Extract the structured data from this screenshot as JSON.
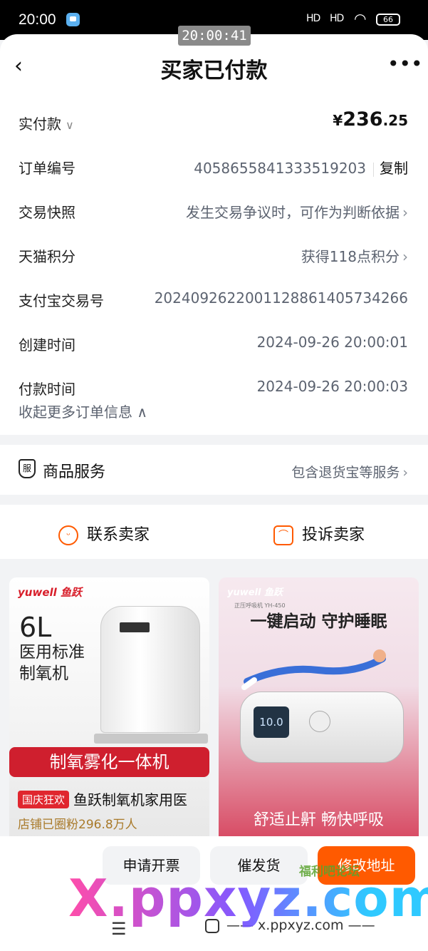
{
  "status_bar": {
    "time": "20:00",
    "signal1": "HD",
    "signal2": "HD",
    "battery": "66"
  },
  "clock_overlay": "20:00:41",
  "nav": {
    "title": "买家已付款",
    "back_icon": "‹",
    "more_icon": "•••"
  },
  "order": {
    "paid": {
      "label": "实付款",
      "caret": "∨",
      "symbol": "¥",
      "int": "236",
      "dec": ".25"
    },
    "order_no": {
      "label": "订单编号",
      "value": "4058655841333519203",
      "copy": "复制"
    },
    "snapshot": {
      "label": "交易快照",
      "value": "发生交易争议时，可作为判断依据"
    },
    "points": {
      "label": "天猫积分",
      "value": "获得118点积分"
    },
    "alipay_no": {
      "label": "支付宝交易号",
      "value": "2024092622001128861405734266"
    },
    "created": {
      "label": "创建时间",
      "value": "2024-09-26 20:00:01"
    },
    "paid_time": {
      "label": "付款时间",
      "value": "2024-09-26 20:00:03"
    },
    "collapse": "收起更多订单信息 ∧"
  },
  "service": {
    "icon_text": "服",
    "label": "商品服务",
    "value": "包含退货宝等服务"
  },
  "contact": {
    "seller": "联系卖家",
    "complain": "投诉卖家"
  },
  "products": [
    {
      "brand": "yuwell 鱼跃",
      "big": "6L",
      "line1": "医用标准",
      "line2": "制氧机",
      "banner": "制氧雾化一体机",
      "tag": "国庆狂欢",
      "title": "鱼跃制氧机家用医",
      "fans": "店铺已圈粉296.8万人"
    },
    {
      "brand": "yuwell 鱼跃",
      "model": "正压呼吸机 YH-450",
      "headline": "一键启动 守护睡眠",
      "screen": "10.0",
      "bottom": "舒适止鼾 畅快呼吸"
    }
  ],
  "actions": {
    "invoice": "申请开票",
    "urge": "催发货",
    "address": "修改地址"
  },
  "watermarks": {
    "small": "福利吧论坛",
    "big": "X.ppxyz.com"
  },
  "gesture": {
    "site": "—— x.ppxyz.com ——"
  },
  "colors": {
    "accent": "#ff5a00",
    "banner_red": "#cf1f2e"
  }
}
